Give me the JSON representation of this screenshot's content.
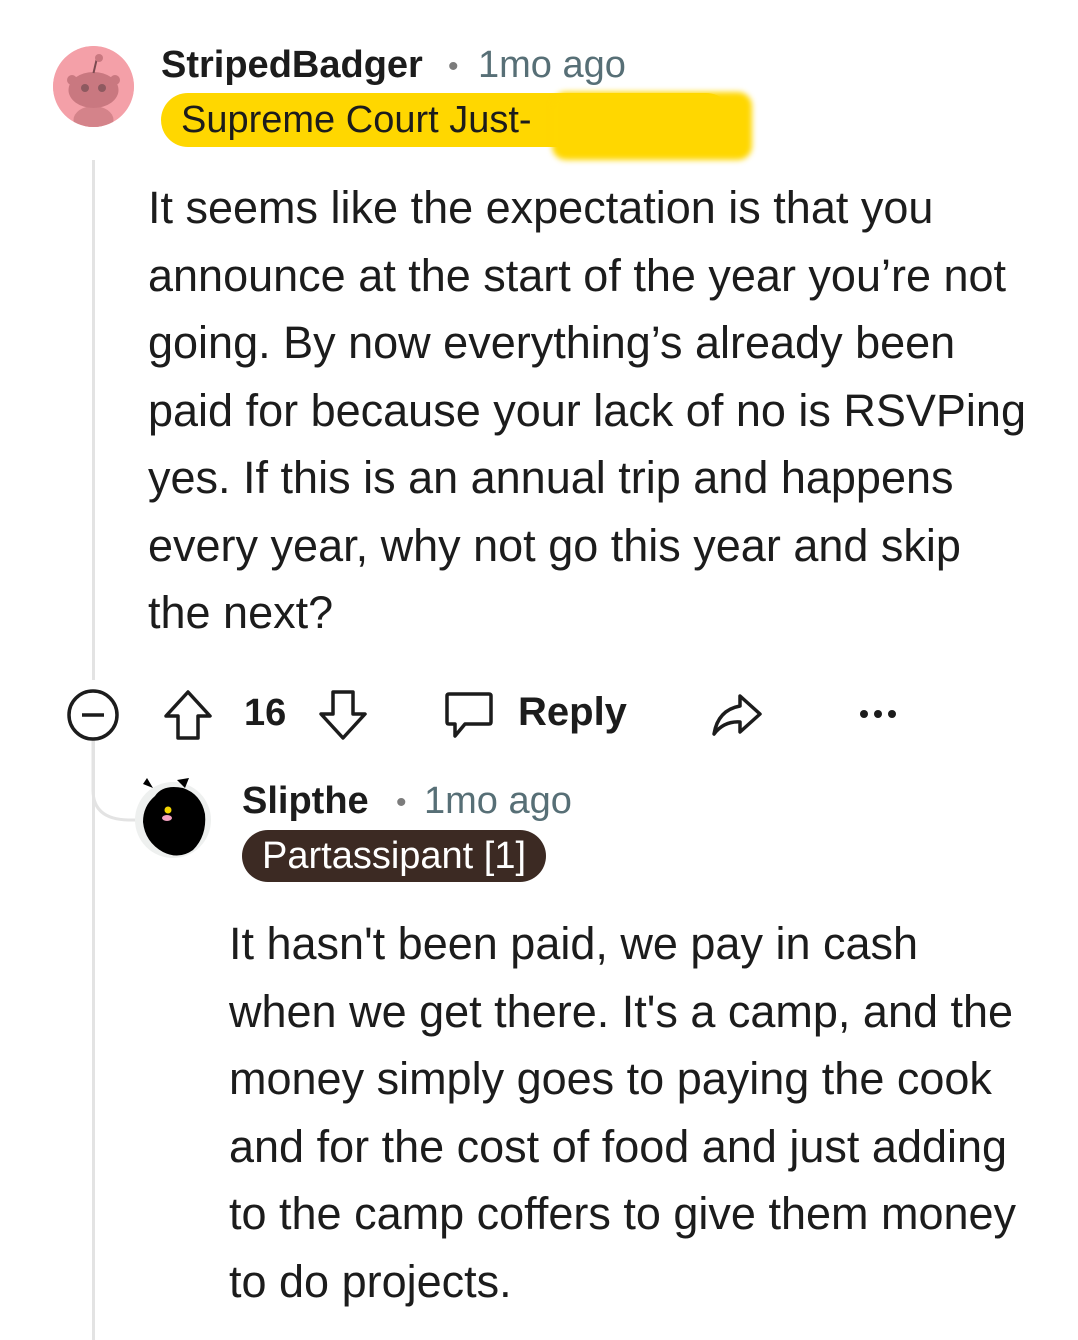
{
  "comment": {
    "username": "StripedBadger",
    "separator": "•",
    "time": "1mo ago",
    "flair": "Supreme Court Just-",
    "body": "It seems like the expectation is that you announce at the start of the year you’re not going. By now everything’s already been paid for because your lack of no is RSVPing yes. If this is an annual trip and happens every year, why not go this year and skip the next?",
    "votes": "16",
    "reply_label": "Reply",
    "icons": [
      "collapse-icon",
      "upvote-icon",
      "downvote-icon",
      "reply-icon",
      "share-icon",
      "more-icon"
    ]
  },
  "reply": {
    "username": "Slipthe",
    "separator": "•",
    "time": "1mo ago",
    "flair": "Partassipant [1]",
    "body": "It hasn't been paid, we pay in cash when we get there. It's a camp, and the money simply goes to paying the cook and for the cost of food and just adding to the camp coffers to give them money to do projects."
  },
  "colors": {
    "flair_yellow": "#ffd700",
    "flair_dark": "#3c2a23",
    "avatar_pink": "#f4a0a8",
    "meta_gray": "#576f76"
  }
}
